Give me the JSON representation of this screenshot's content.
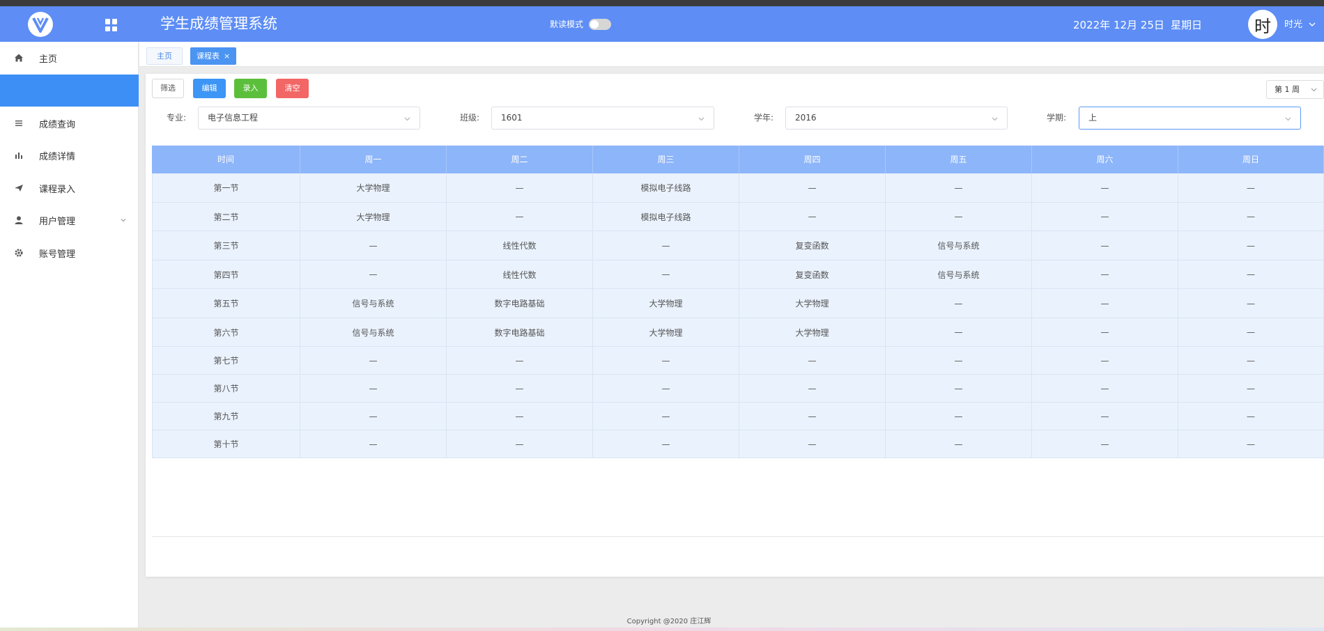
{
  "header": {
    "app_title": "学生成绩管理系统",
    "mode_label": "默读模式",
    "mode_on": false,
    "date": "2022年 12月 25日",
    "weekday": "星期日",
    "avatar_char": "时",
    "username": "时光"
  },
  "sidebar": {
    "items": [
      {
        "label": "主页",
        "icon": "home-icon"
      },
      {
        "label": "",
        "icon": ""
      },
      {
        "label": "成绩查询",
        "icon": "list-icon"
      },
      {
        "label": "成绩详情",
        "icon": "bar-chart-icon"
      },
      {
        "label": "课程录入",
        "icon": "send-icon"
      },
      {
        "label": "用户管理",
        "icon": "user-icon"
      },
      {
        "label": "账号管理",
        "icon": "gear-icon"
      }
    ]
  },
  "tabs": [
    {
      "label": "主页",
      "active": false
    },
    {
      "label": "课程表",
      "active": true,
      "close": "×"
    }
  ],
  "toolbar": {
    "filter": "筛选",
    "edit": "编辑",
    "enter": "录入",
    "clear": "清空",
    "week": "第 1 周"
  },
  "filters": {
    "major_label": "专业:",
    "major_value": "电子信息工程",
    "class_label": "班级:",
    "class_value": "1601",
    "year_label": "学年:",
    "year_value": "2016",
    "term_label": "学期:",
    "term_value": "上"
  },
  "timetable": {
    "headers": [
      "时间",
      "周一",
      "周二",
      "周三",
      "周四",
      "周五",
      "周六",
      "周日"
    ],
    "rows": [
      [
        "第一节",
        "大学物理",
        "—",
        "模拟电子线路",
        "—",
        "—",
        "—",
        "—"
      ],
      [
        "第二节",
        "大学物理",
        "—",
        "模拟电子线路",
        "—",
        "—",
        "—",
        "—"
      ],
      [
        "第三节",
        "—",
        "线性代数",
        "—",
        "复变函数",
        "信号与系统",
        "—",
        "—"
      ],
      [
        "第四节",
        "—",
        "线性代数",
        "—",
        "复变函数",
        "信号与系统",
        "—",
        "—"
      ],
      [
        "第五节",
        "信号与系统",
        "数字电路基础",
        "大学物理",
        "大学物理",
        "—",
        "—",
        "—"
      ],
      [
        "第六节",
        "信号与系统",
        "数字电路基础",
        "大学物理",
        "大学物理",
        "—",
        "—",
        "—"
      ],
      [
        "第七节",
        "—",
        "—",
        "—",
        "—",
        "—",
        "—",
        "—"
      ],
      [
        "第八节",
        "—",
        "—",
        "—",
        "—",
        "—",
        "—",
        "—"
      ],
      [
        "第九节",
        "—",
        "—",
        "—",
        "—",
        "—",
        "—",
        "—"
      ],
      [
        "第十节",
        "—",
        "—",
        "—",
        "—",
        "—",
        "—",
        "—"
      ]
    ]
  },
  "footer": {
    "copyright": "Copyright @2020 庄江辉"
  },
  "colors": {
    "header_bg": "#5d8df5",
    "sidebar_active": "#3d8ff5",
    "table_header": "#8db5f9",
    "row_bg": "#eaf2fd"
  }
}
